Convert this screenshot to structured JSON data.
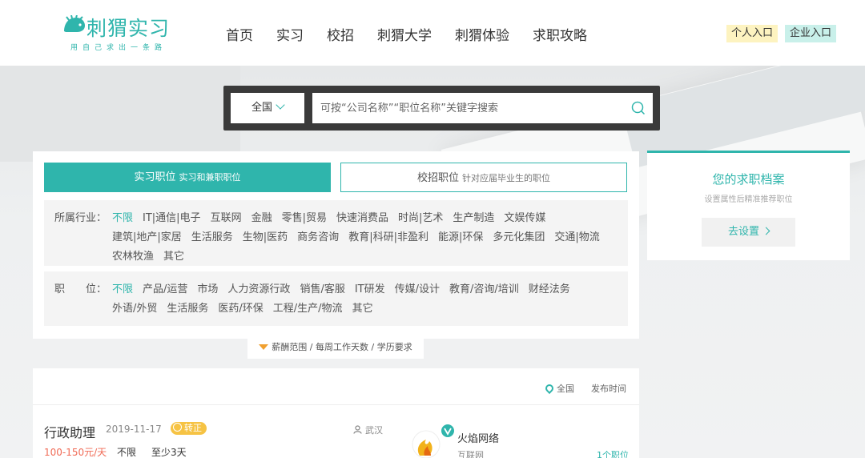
{
  "brand": {
    "name": "刺猬实习",
    "slogan": "用自己求出一条路",
    "color": "#2fb5ac"
  },
  "nav": [
    "首页",
    "实习",
    "校招",
    "刺猬大学",
    "刺猬体验",
    "求职攻略"
  ],
  "entries": {
    "personal": "个人入口",
    "company": "企业入口"
  },
  "search": {
    "region": "全国",
    "placeholder": "可按“公司名称”“职位名称”关键字搜索"
  },
  "tabs": [
    {
      "label": "实习职位",
      "sub": "实习和兼职职位"
    },
    {
      "label": "校招职位",
      "sub": "针对应届毕业生的职位"
    }
  ],
  "industry": {
    "label": "所属行业：",
    "options": [
      "不限",
      "IT|通信|电子",
      "互联网",
      "金融",
      "零售|贸易",
      "快速消费品",
      "时尚|艺术",
      "生产制造",
      "文娱传媒",
      "建筑|地产|家居",
      "生活服务",
      "生物|医药",
      "商务咨询",
      "教育|科研|非盈利",
      "能源|环保",
      "多元化集团",
      "交通|物流",
      "农林牧渔",
      "其它"
    ]
  },
  "position": {
    "label": "职　　位：",
    "options": [
      "不限",
      "产品/运营",
      "市场",
      "人力资源行政",
      "销售/客服",
      "IT研发",
      "传媒/设计",
      "教育/咨询/培训",
      "财经法务",
      "外语/外贸",
      "生活服务",
      "医药/环保",
      "工程/生产/物流",
      "其它"
    ]
  },
  "more_filters": "薪酬范围 / 每周工作天数 / 学历要求",
  "profile": {
    "title": "您的求职档案",
    "subtitle": "设置属性后精准推荐职位",
    "button": "去设置"
  },
  "list_bar": {
    "location": "全国",
    "sort": "发布时间"
  },
  "job": {
    "title": "行政助理",
    "date": "2019-11-17",
    "badge": "转正",
    "city": "武汉",
    "salary": "100-150元/天",
    "education": "不限",
    "days": "至少3天",
    "company": {
      "name": "火焰网络",
      "industry": "互联网",
      "jobs": "1个职位"
    }
  }
}
